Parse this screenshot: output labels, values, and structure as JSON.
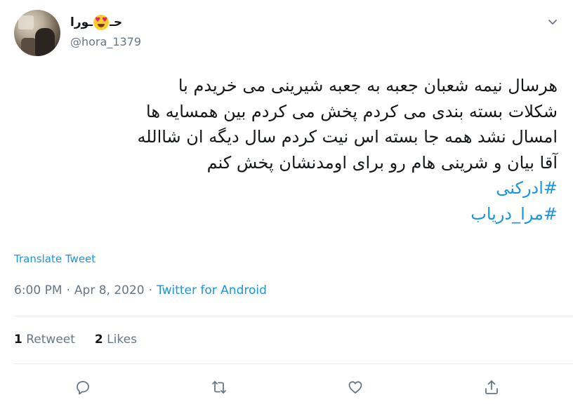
{
  "author": {
    "display_name_left": "حـ",
    "display_name_emoji": "smiling-face-with-heart-eyes",
    "display_name_right": "ـورا",
    "handle": "@hora_1379"
  },
  "tweet": {
    "lines": [
      "هرسال نیمه شعبان جعبه به جعبه شیرینی می خریدم با",
      "شکلات بسته بندی می کردم پخش می کردم بین همسایه ها",
      "امسال نشد همه جا بسته اس نیت کردم سال دیگه ان شاالله",
      "آقا بیان و شرینی هام رو برای اومدنشان پخش کنم"
    ],
    "hashtags": [
      "#ادرکنی",
      "#مرا_دریاب"
    ]
  },
  "translate_label": "Translate Tweet",
  "meta": {
    "time": "6:00 PM",
    "separator": "·",
    "date": "Apr 8, 2020",
    "source": "Twitter for Android"
  },
  "stats": {
    "retweets_count": "1",
    "retweets_label": "Retweet",
    "likes_count": "2",
    "likes_label": "Likes"
  },
  "actions": {
    "reply_icon": "reply-icon",
    "retweet_icon": "retweet-icon",
    "like_icon": "heart-icon",
    "share_icon": "share-icon"
  },
  "colors": {
    "link": "#1b95e0",
    "secondary_text": "#657786",
    "primary_text": "#14171a",
    "divider": "#e6ecf0"
  }
}
